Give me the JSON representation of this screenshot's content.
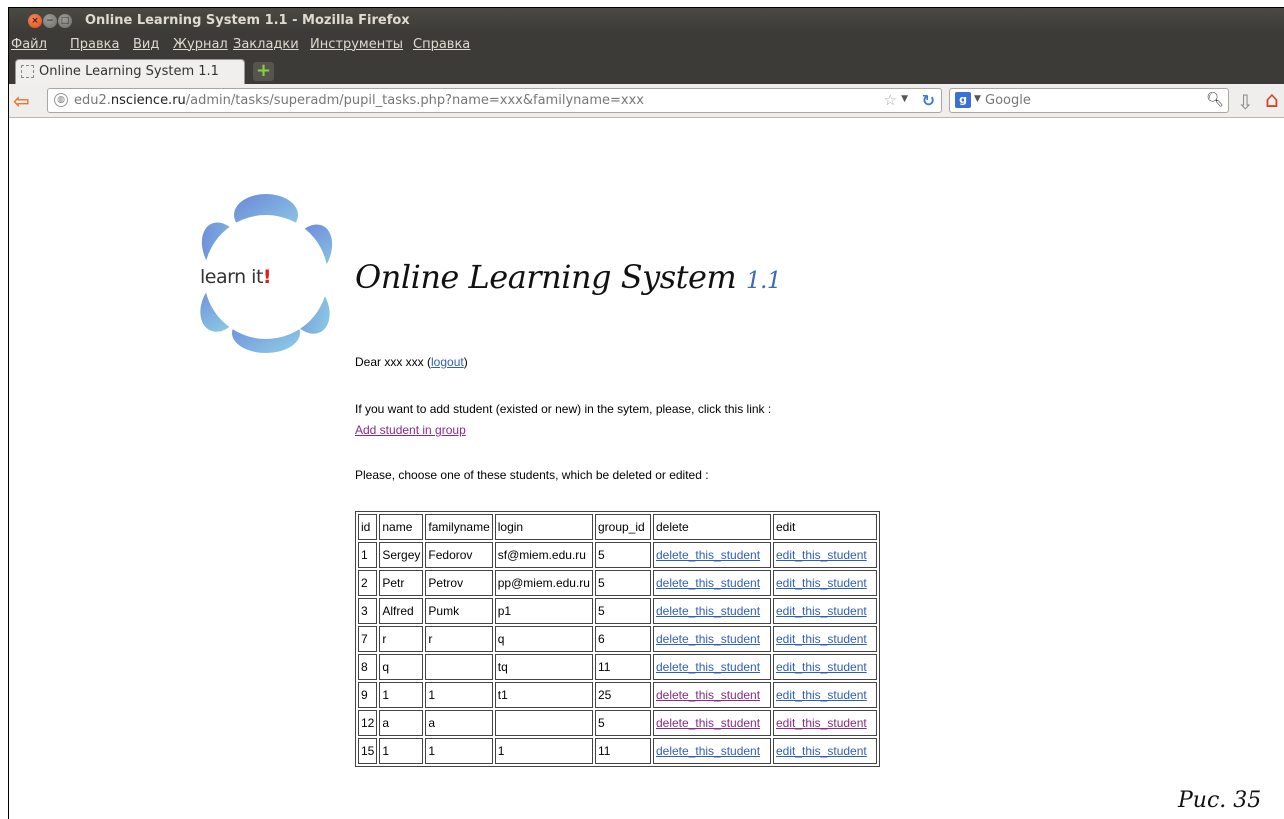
{
  "window": {
    "title": "Online Learning System 1.1 - Mozilla Firefox"
  },
  "menu": [
    "Файл",
    "Правка",
    "Вид",
    "Журнал",
    "Закладки",
    "Инструменты",
    "Справка"
  ],
  "tab": {
    "label": "Online Learning System 1.1",
    "new_tab_symbol": "+"
  },
  "navigation": {
    "url_prefix": "edu2.",
    "url_domain": "nscience.ru",
    "url_path": "/admin/tasks/superadm/pupil_tasks.php?name=xxx&familyname=xxx",
    "search_engine": "Google"
  },
  "icons": {
    "back": "back-arrow-icon",
    "site_identity": "globe-icon",
    "bookmark": "star-icon",
    "reload": "reload-icon",
    "search_engine": "google-icon",
    "search": "magnifier-icon",
    "downloads": "download-arrow-icon",
    "home": "home-icon"
  },
  "page": {
    "logo_text": "learn it",
    "logo_bang": "!",
    "title": "Online Learning System",
    "version": "1.1",
    "greeting_prefix": "Dear xxx xxx (",
    "logout_link": "logout",
    "greeting_suffix": ")",
    "add_intro": "If you want to add student (existed or new) in the sytem, please, click this link :",
    "add_link": "Add student in group",
    "choose_text": "Please, choose one of these students, which be deleted or edited :"
  },
  "table": {
    "headers": [
      "id",
      "name",
      "familyname",
      "login",
      "group_id",
      "delete",
      "edit"
    ],
    "rows": [
      {
        "id": "1",
        "name": "Sergey",
        "familyname": "Fedorov",
        "login": "sf@miem.edu.ru",
        "group_id": "5",
        "delete": "delete_this_student",
        "edit": "edit_this_student",
        "delete_visited": false,
        "edit_visited": false
      },
      {
        "id": "2",
        "name": "Petr",
        "familyname": "Petrov",
        "login": "pp@miem.edu.ru",
        "group_id": "5",
        "delete": "delete_this_student",
        "edit": "edit_this_student",
        "delete_visited": false,
        "edit_visited": false
      },
      {
        "id": "3",
        "name": "Alfred",
        "familyname": "Pumk",
        "login": "p1",
        "group_id": "5",
        "delete": "delete_this_student",
        "edit": "edit_this_student",
        "delete_visited": false,
        "edit_visited": false
      },
      {
        "id": "7",
        "name": "r",
        "familyname": "r",
        "login": "q",
        "group_id": "6",
        "delete": "delete_this_student",
        "edit": "edit_this_student",
        "delete_visited": false,
        "edit_visited": false
      },
      {
        "id": "8",
        "name": "q",
        "familyname": "",
        "login": "tq",
        "group_id": "11",
        "delete": "delete_this_student",
        "edit": "edit_this_student",
        "delete_visited": false,
        "edit_visited": false
      },
      {
        "id": "9",
        "name": "1",
        "familyname": "1",
        "login": "t1",
        "group_id": "25",
        "delete": "delete_this_student",
        "edit": "edit_this_student",
        "delete_visited": true,
        "edit_visited": false
      },
      {
        "id": "12",
        "name": "a",
        "familyname": "a",
        "login": "",
        "group_id": "5",
        "delete": "delete_this_student",
        "edit": "edit_this_student",
        "delete_visited": true,
        "edit_visited": true
      },
      {
        "id": "15",
        "name": "1",
        "familyname": "1",
        "login": "1",
        "group_id": "11",
        "delete": "delete_this_student",
        "edit": "edit_this_student",
        "delete_visited": false,
        "edit_visited": false
      }
    ]
  },
  "caption": "Рис. 35",
  "colors": {
    "link": "#2e5fbf",
    "visited_link": "#8a2a8a",
    "version": "#3f6ab3",
    "logo_petals": [
      "#6f8fde",
      "#7fb0e6",
      "#8ccbe3"
    ]
  }
}
